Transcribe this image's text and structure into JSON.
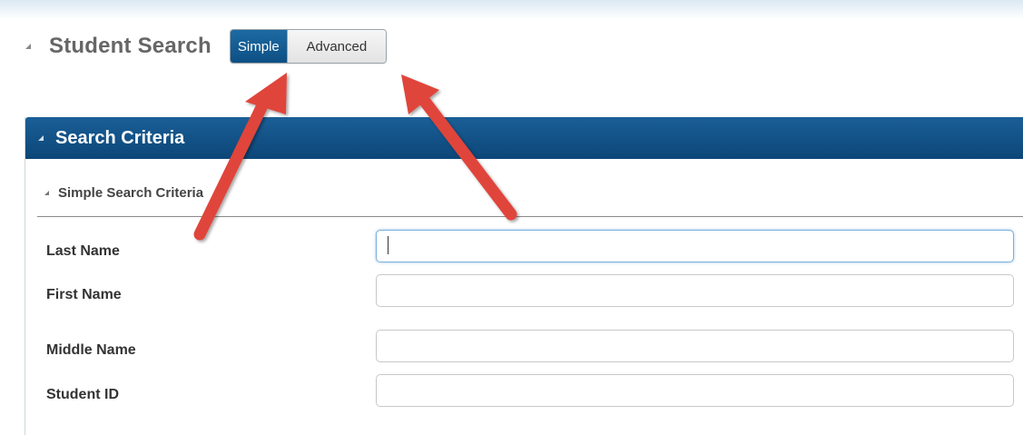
{
  "header": {
    "title": "Student Search",
    "mode_toggle": {
      "simple_label": "Simple",
      "advanced_label": "Advanced",
      "selected": "Simple"
    }
  },
  "panel": {
    "title": "Search Criteria",
    "section_title": "Simple Search Criteria"
  },
  "fields": {
    "last_name": {
      "label": "Last Name",
      "value": ""
    },
    "first_name": {
      "label": "First Name",
      "value": ""
    },
    "middle_name": {
      "label": "Middle Name",
      "value": ""
    },
    "student_id": {
      "label": "Student ID",
      "value": ""
    }
  },
  "colors": {
    "accent": "#0d4f84",
    "annotation_arrow": "#e0443b"
  },
  "icons": [
    "collapse-triangle-icon",
    "annotation-arrow"
  ]
}
